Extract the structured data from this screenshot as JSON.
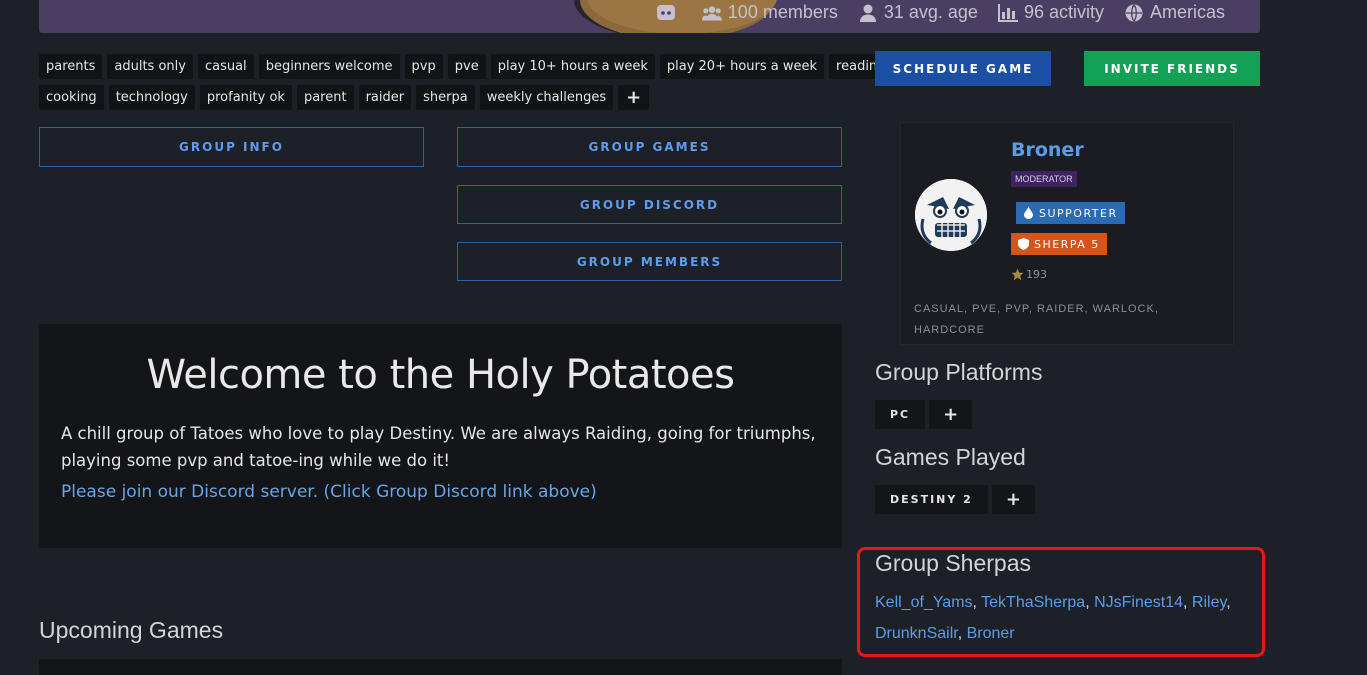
{
  "banner": {
    "stats": [
      {
        "icon": "discord-icon",
        "label": ""
      },
      {
        "icon": "members-icon",
        "label": "100 members"
      },
      {
        "icon": "user-icon",
        "label": "31 avg. age"
      },
      {
        "icon": "activity-chart-icon",
        "label": "96 activity"
      },
      {
        "icon": "globe-icon",
        "label": "Americas"
      }
    ]
  },
  "tags": {
    "row1": [
      "parents",
      "adults only",
      "casual",
      "beginners welcome",
      "pvp",
      "pve",
      "play 10+ hours a week",
      "play 20+ hours a week",
      "reading"
    ],
    "row2": [
      "cooking",
      "technology",
      "profanity ok",
      "parent",
      "raider",
      "sherpa",
      "weekly challenges"
    ],
    "add": "+"
  },
  "actions": {
    "schedule_game": "SCHEDULE GAME",
    "invite_friends": "INVITE FRIENDS",
    "schedule_color": "#1a4fa3",
    "invite_color": "#13a155"
  },
  "nav": {
    "group_info": "GROUP INFO",
    "group_games": "GROUP GAMES",
    "group_discord": "GROUP DISCORD",
    "group_members": "GROUP MEMBERS"
  },
  "welcome": {
    "title": "Welcome to the Holy Potatoes",
    "body": "A chill group of Tatoes who love to play Destiny. We are always Raiding, going for triumphs, playing some pvp and tatoe-ing while we do it!",
    "link": "Please join our Discord server. (Click Group Discord link above)"
  },
  "upcoming": {
    "title": "Upcoming Games"
  },
  "profile": {
    "name": "Broner",
    "role": "MODERATOR",
    "supporter": "SUPPORTER",
    "sherpa": "SHERPA 5",
    "rating": "193",
    "tags": "CASUAL, PVE, PVP, RAIDER, WARLOCK, HARDCORE",
    "supporter_color": "#2a6bb3",
    "sherpa_color": "#d4541b"
  },
  "platforms": {
    "title": "Group Platforms",
    "items": [
      "PC"
    ],
    "add": "+"
  },
  "games": {
    "title": "Games Played",
    "items": [
      "DESTINY 2"
    ],
    "add": "+"
  },
  "sherpas": {
    "title": "Group Sherpas",
    "names": [
      "Kell_of_Yams",
      "TekThaSherpa",
      "NJsFinest14",
      "Riley",
      "DrunknSailr",
      "Broner"
    ],
    "separator": ", "
  }
}
